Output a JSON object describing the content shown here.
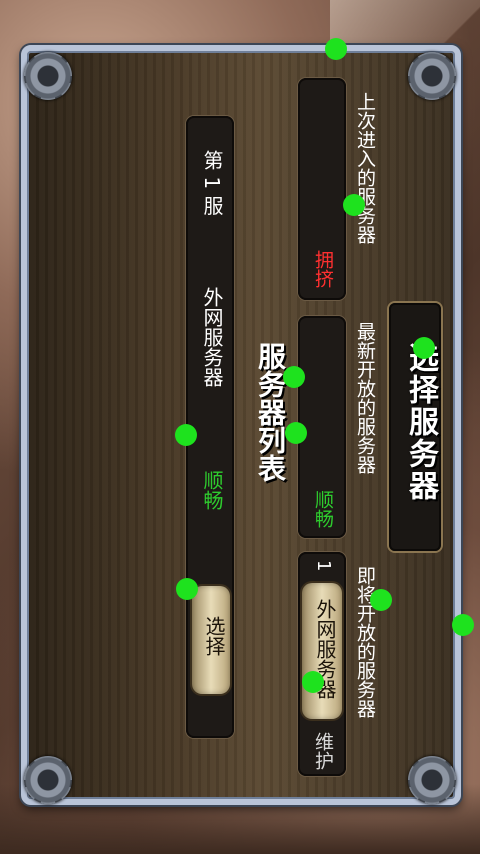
{
  "dialog": {
    "title": "选择服务器"
  },
  "last_entered": {
    "label": "上次进入的服务器",
    "status": "拥挤"
  },
  "newest": {
    "label": "最新开放的服务器",
    "status": "顺畅"
  },
  "upcoming": {
    "label": "即将开放的服务器",
    "number": "1",
    "button_label": "外网服务器",
    "status": "维护"
  },
  "server_list": {
    "title": "服务器列表",
    "rows": [
      {
        "name": "第 1 服",
        "type": "外网服务器",
        "status": "顺畅",
        "button_label": "选择"
      }
    ]
  },
  "colors": {
    "status_crowded": "#ff3030",
    "status_smooth": "#2ecc2e",
    "status_maintenance": "#d8d8d8",
    "frame": "#b9c4d8",
    "button": "#e8dcb8"
  }
}
